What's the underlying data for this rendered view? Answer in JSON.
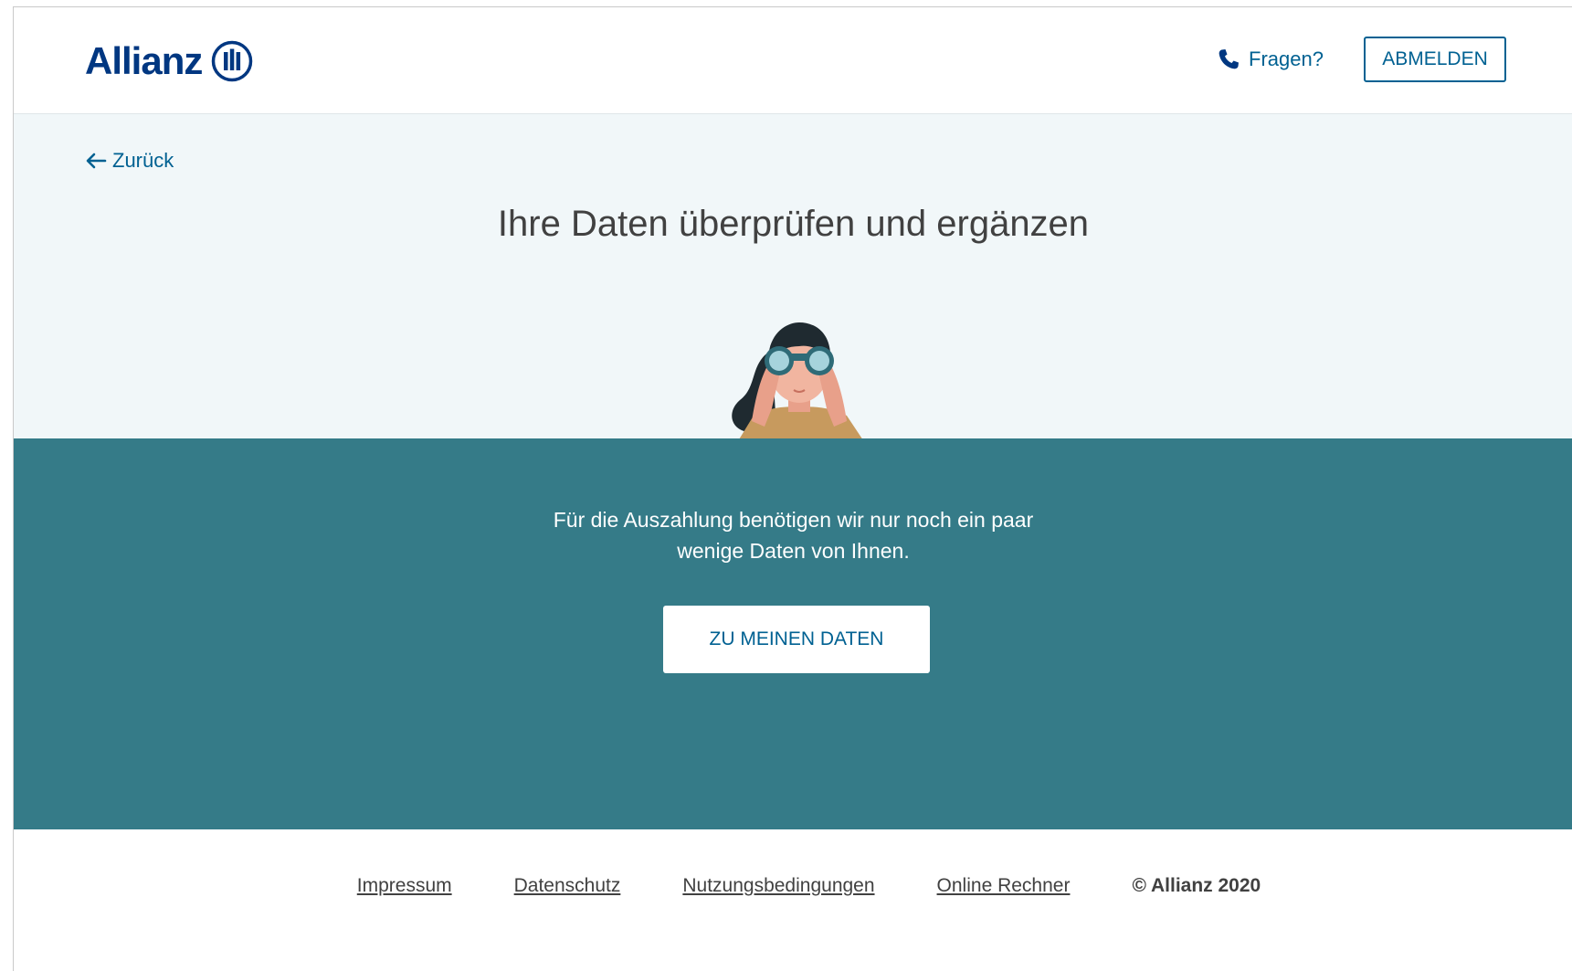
{
  "header": {
    "logo_text": "Allianz",
    "help_label": "Fragen?",
    "logout_label": "ABMELDEN"
  },
  "hero": {
    "back_label": "Zurück",
    "title": "Ihre Daten überprüfen und ergänzen"
  },
  "band": {
    "message_line1": "Für die Auszahlung benötigen wir nur noch ein paar",
    "message_line2": "wenige Daten von Ihnen.",
    "cta_label": "ZU MEINEN DATEN"
  },
  "footer": {
    "links": [
      "Impressum",
      "Datenschutz",
      "Nutzungsbedingungen",
      "Online Rechner"
    ],
    "copyright": "© Allianz 2020"
  },
  "icons": {
    "logo_mark": "allianz-eagle-mark",
    "help": "phone-icon",
    "back": "arrow-left-icon",
    "illustration": "woman-with-binoculars-illustration"
  },
  "colors": {
    "brand_blue": "#003781",
    "link_blue": "#006192",
    "hero_bg": "#f1f7f9",
    "band_teal": "#357b88",
    "text_dark": "#414141"
  }
}
